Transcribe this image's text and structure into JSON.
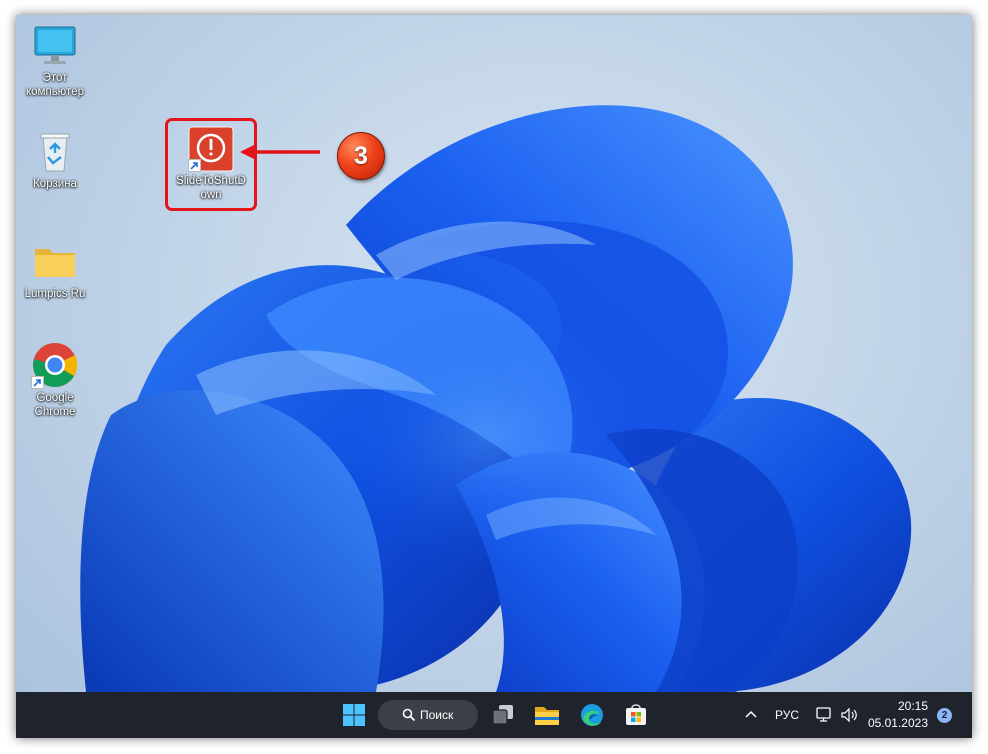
{
  "desktop": {
    "icons": [
      {
        "label": "Этот компьютер",
        "line1": "Этот",
        "line2": "компьютер"
      },
      {
        "label": "Корзина",
        "line1": "Корзина",
        "line2": ""
      },
      {
        "label": "Lumpics Ru",
        "line1": "Lumpics Ru",
        "line2": ""
      },
      {
        "label": "Google Chrome",
        "line1": "Google",
        "line2": "Chrome"
      },
      {
        "label": "SlideToShutDown",
        "line1": "SlideToShutD",
        "line2": "own"
      }
    ]
  },
  "annotation": {
    "step_number": "3",
    "accent_color": "#e4141b"
  },
  "taskbar": {
    "search_label": "Поиск",
    "language": "РУС",
    "time": "20:15",
    "date": "05.01.2023",
    "notification_count": "2",
    "apps": [
      "start-icon",
      "search-icon",
      "task-view-icon",
      "file-explorer-icon",
      "edge-icon",
      "store-icon"
    ]
  }
}
